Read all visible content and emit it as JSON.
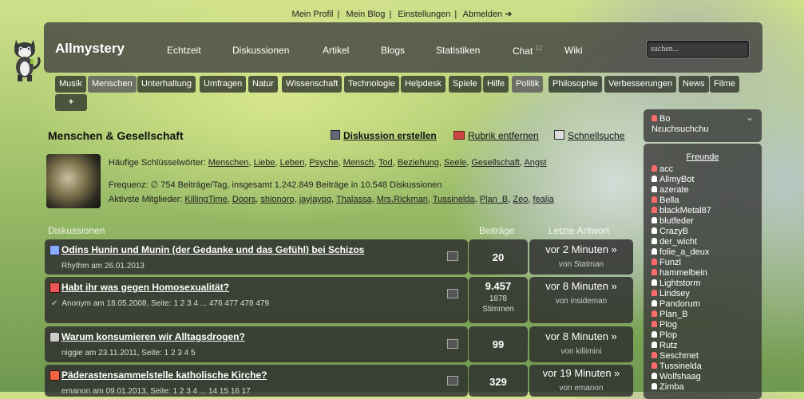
{
  "top_links": [
    "Mein Profil",
    "Mein Blog",
    "Einstellungen",
    "Abmelden ➔"
  ],
  "brand": "Allmystery",
  "nav": [
    {
      "label": "Echtzeit"
    },
    {
      "label": "Diskussionen"
    },
    {
      "label": "Artikel"
    },
    {
      "label": "Blogs"
    },
    {
      "label": "Statistiken"
    },
    {
      "label": "Chat",
      "badge": "12"
    },
    {
      "label": "Wiki"
    }
  ],
  "search": {
    "placeholder": "suchen..."
  },
  "tabs": [
    "Musik",
    "Menschen",
    "Unterhaltung",
    "Umfragen",
    "Natur",
    "Wissenschaft",
    "Technologie",
    "Helpdesk",
    "Spiele",
    "Hilfe",
    "Politik",
    "Philosophie",
    "Verbesserungen",
    "News",
    "Filme",
    "+"
  ],
  "active_tab": "Menschen",
  "section": {
    "title": "Menschen & Gesellschaft",
    "actions": [
      "Diskussion erstellen",
      "Rubrik entfernen",
      "Schnellsuche"
    ],
    "keywords_label": "Häufige Schlüsselwörter:",
    "keywords": [
      "Menschen",
      "Liebe",
      "Leben",
      "Psyche",
      "Mensch",
      "Tod",
      "Beziehung",
      "Seele",
      "Gesellschaft",
      "Angst"
    ],
    "frequency": "Frequenz: ∅ 754 Beiträge/Tag, insgesamt 1.242.849 Beiträge in 10.548 Diskussionen",
    "active_label": "Aktivste Mitglieder:",
    "active_members": [
      "KillingTime",
      "Doors",
      "shionoro",
      "jayjaypq",
      "Thalassa",
      "Mrs.Rickman",
      "Tussinelda",
      "Plan_B",
      "Zeo",
      "fealia"
    ]
  },
  "columns": {
    "discussions": "Diskussionen",
    "posts": "Beiträge",
    "last": "Letzte Antwort"
  },
  "threads": [
    {
      "title": "Odins Hunin und Munin (der Gedanke und das Gefühl) bei Schizos",
      "sub": "Rhythm am 26.01.2013",
      "count": "20",
      "extra": "",
      "extra2": "",
      "last": "vor 2 Minuten »",
      "by": "von Statman"
    },
    {
      "title": "Habt ihr was gegen Homosexualität?",
      "sub": "Anonym am 18.05.2008, Seite: 1 2 3 4 ... 476 477 478 479",
      "count": "9.457",
      "extra": "1878",
      "extra2": "Stimmen",
      "last": "vor 8 Minuten »",
      "by": "von insideman"
    },
    {
      "title": "Warum konsumieren wir Alltagsdrogen?",
      "sub": "niggie am 23.11.2011, Seite: 1 2 3 4 5",
      "count": "99",
      "extra": "",
      "extra2": "",
      "last": "vor 8 Minuten »",
      "by": "von killimini"
    },
    {
      "title": "Päderastensammelstelle katholische Kirche?",
      "sub": "emanon am 09.01.2013, Seite: 1 2 3 4 ... 14 15 16 17",
      "count": "329",
      "extra": "",
      "extra2": "",
      "last": "vor 19 Minuten »",
      "by": "von emanon"
    }
  ],
  "sidebar": {
    "status_top": "Bo",
    "status_mirror": "Nεuchsuchchu",
    "friends_title": "Freunde",
    "friends": [
      "acc",
      "AllmyBot",
      "azerate",
      "Bella",
      "blackMetal87",
      "blutfeder",
      "CrazyB",
      "der_wicht",
      "folie_a_deux",
      "Funzl",
      "hammelbein",
      "Lightstorm",
      "Lindsey",
      "Pandorum",
      "Plan_B",
      "Plog",
      "Plop",
      "Rutz",
      "Seschmet",
      "Tussinelda",
      "Wolfshaag",
      "Zimba"
    ]
  },
  "colors": {
    "accent": "#3a3a3a",
    "male": "#ffffff",
    "female": "#ff6b6b"
  }
}
